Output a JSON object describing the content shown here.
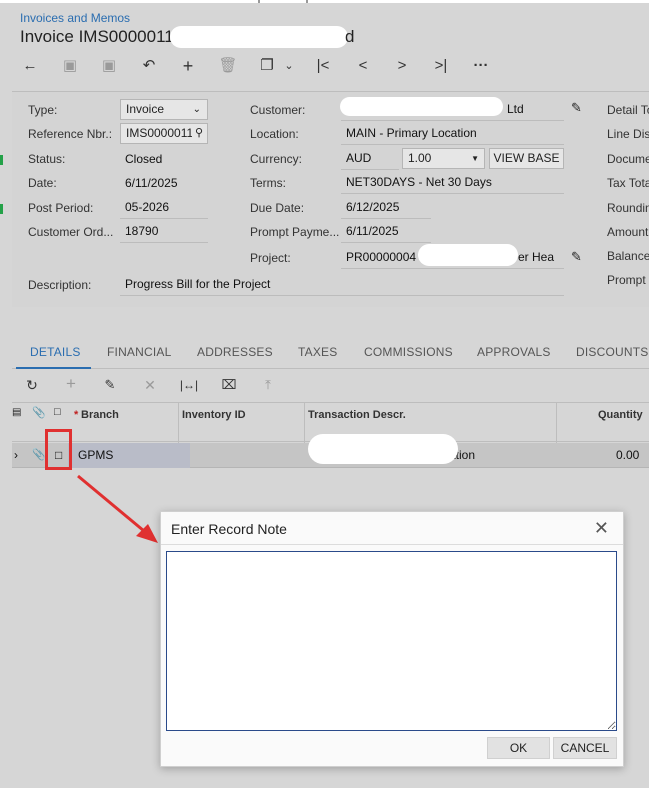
{
  "breadcrumb": "Invoices and Memos",
  "title": "Invoice IMS0000011",
  "title_suffix": "d",
  "toolbar": {
    "more_label": "···"
  },
  "form": {
    "type_label": "Type:",
    "type_value": "Invoice",
    "refnbr_label": "Reference Nbr.:",
    "refnbr_value": "IMS0000011",
    "status_label": "Status:",
    "status_value": "Closed",
    "date_label": "Date:",
    "date_value": "6/11/2025",
    "postperiod_label": "Post Period:",
    "postperiod_value": "05-2026",
    "custord_label": "Customer Ord...",
    "custord_value": "18790",
    "description_label": "Description:",
    "description_value": "Progress Bill for the Project",
    "customer_label": "Customer:",
    "customer_value_tail": "Ltd",
    "location_label": "Location:",
    "location_value": "MAIN - Primary Location",
    "currency_label": "Currency:",
    "currency_value": "AUD",
    "rate_value": "1.00",
    "view_base_label": "VIEW BASE",
    "terms_label": "Terms:",
    "terms_value": "NET30DAYS - Net 30 Days",
    "duedate_label": "Due Date:",
    "duedate_value": "6/12/2025",
    "promptpay_label": "Prompt Payme...",
    "promptpay_value": "6/11/2025",
    "project_label": "Project:",
    "project_value": "PR00000004",
    "project_value_tail": "er Hea",
    "right_labels": [
      "Detail To",
      "Line Dis",
      "Docume",
      "Tax Tota",
      "Roundin",
      "Amount:",
      "Balance",
      "Prompt I"
    ]
  },
  "tabs": [
    "DETAILS",
    "FINANCIAL",
    "ADDRESSES",
    "TAXES",
    "COMMISSIONS",
    "APPROVALS",
    "DISCOUNTS"
  ],
  "grid": {
    "columns": {
      "branch": "Branch",
      "required_mark": "*",
      "inventory": "Inventory ID",
      "descr": "Transaction Descr.",
      "quantity": "Quantity"
    },
    "row": {
      "branch": "GPMS",
      "descr_tail": "ation",
      "quantity": "0.00"
    }
  },
  "dialog": {
    "title": "Enter Record Note",
    "note_value": "",
    "ok_label": "OK",
    "cancel_label": "CANCEL"
  },
  "colors": {
    "accent": "#2a6db0",
    "highlight_red": "#e03030"
  }
}
